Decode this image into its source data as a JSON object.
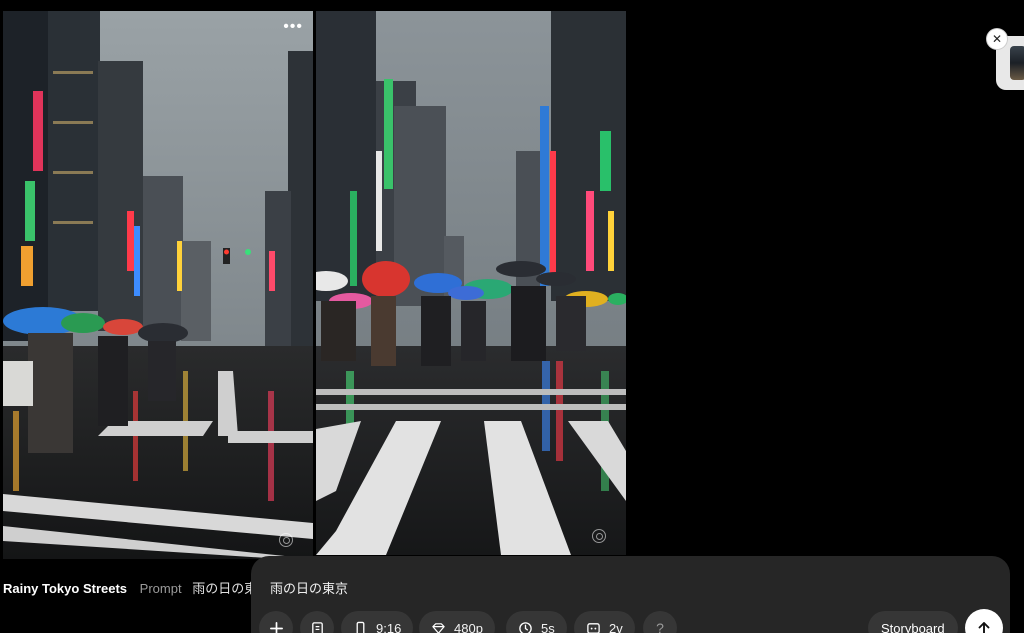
{
  "video_card": {
    "title": "Rainy Tokyo Streets",
    "prompt_label": "Prompt",
    "prompt_text": "雨の日の東"
  },
  "icons": {
    "more": "more-horizontal-icon",
    "watermark": "watermark-icon",
    "close": "close-icon"
  },
  "more_glyph": "•••",
  "close_glyph": "✕",
  "composer": {
    "prompt_value": "雨の日の東京",
    "aspect_label": "9:16",
    "resolution_label": "480p",
    "duration_label": "5s",
    "variations_label": "2v",
    "help_label": "?",
    "storyboard_label": "Storyboard"
  },
  "colors": {
    "background": "#000000",
    "composer_bg": "#262626",
    "pill_bg": "#363636"
  }
}
